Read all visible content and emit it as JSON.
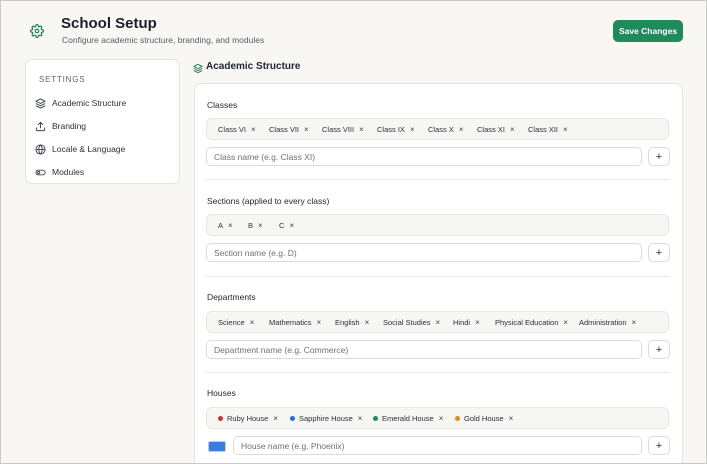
{
  "header": {
    "title": "School Setup",
    "subtitle": "Configure academic structure, branding, and modules",
    "icon": "gear-icon",
    "save_label": "Save Changes",
    "accent": "#1f8a5a"
  },
  "sidebar": {
    "heading": "SETTINGS",
    "items": [
      {
        "label": "Academic Structure",
        "icon": "layers-icon",
        "active": true
      },
      {
        "label": "Branding",
        "icon": "upload-icon"
      },
      {
        "label": "Locale & Language",
        "icon": "globe-icon"
      },
      {
        "label": "Modules",
        "icon": "toggle-icon"
      }
    ]
  },
  "main": {
    "section_title": "Academic Structure",
    "remove_glyph": "×",
    "add_glyph": "+",
    "classes": {
      "label": "Classes",
      "chips": [
        "Class VI",
        "Class VII",
        "Class VIII",
        "Class IX",
        "Class X",
        "Class XI",
        "Class XII"
      ],
      "placeholder": "Class name (e.g. Class XI)"
    },
    "sections": {
      "label": "Sections (applied to every class)",
      "chips": [
        "A",
        "B",
        "C"
      ],
      "placeholder": "Section name (e.g. D)"
    },
    "departments": {
      "label": "Departments",
      "chips": [
        "Science",
        "Mathematics",
        "English",
        "Social Studies",
        "Hindi",
        "Physical Education",
        "Administration"
      ],
      "placeholder": "Department name (e.g. Commerce)"
    },
    "houses": {
      "label": "Houses",
      "chips": [
        {
          "name": "Ruby House",
          "color": "#c0392b"
        },
        {
          "name": "Sapphire House",
          "color": "#2e6bd1"
        },
        {
          "name": "Emerald House",
          "color": "#1f8a5a"
        },
        {
          "name": "Gold House",
          "color": "#e08a1e"
        }
      ],
      "placeholder": "House name (e.g. Phoenix)",
      "new_color": "#3b7ddd"
    }
  }
}
